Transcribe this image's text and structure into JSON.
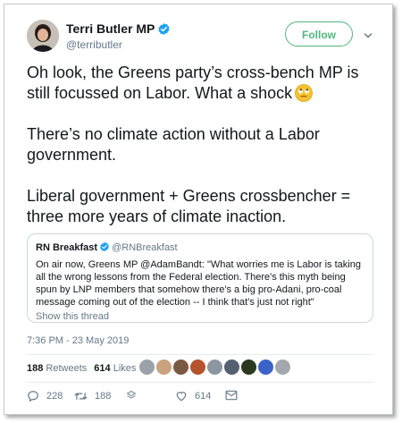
{
  "author": {
    "name": "Terri Butler MP",
    "handle": "@terributler"
  },
  "follow_label": "Follow",
  "tweet": {
    "paragraphs": [
      "Oh look, the Greens party’s cross-bench MP is still focussed on Labor. What a shock",
      "There’s no climate action without a Labor government.",
      "Liberal government + Greens crossbencher = three more years of climate inaction."
    ],
    "emoji": "face-with-rolling-eyes"
  },
  "quoted": {
    "name": "RN Breakfast",
    "handle": "@RNBreakfast",
    "text": "On air now, Greens MP @AdamBandt: \"What worries me is Labor is taking all the wrong lessons from the Federal election. There's this myth being spun by LNP members that somehow there's a big pro-Adani, pro-coal message coming out of the election -- I think that's just not right\"",
    "show_thread": "Show this thread"
  },
  "timestamp": "7:36 PM - 23 May 2019",
  "stats": {
    "retweets_count": "188",
    "retweets_label": "Retweets",
    "likes_count": "614",
    "likes_label": "Likes"
  },
  "likers": [
    "#9aa3ab",
    "#c9a27e",
    "#7b5a44",
    "#b4532e",
    "#8c96a0",
    "#556070",
    "#2b3a1e",
    "#3b63c9",
    "#a2a8ae"
  ],
  "actions": {
    "reply_count": "228",
    "retweet_count": "188",
    "like_count": "614"
  },
  "colors": {
    "follow_accent": "#4fb67f",
    "verified": "#1da1f2",
    "muted": "#657786"
  }
}
